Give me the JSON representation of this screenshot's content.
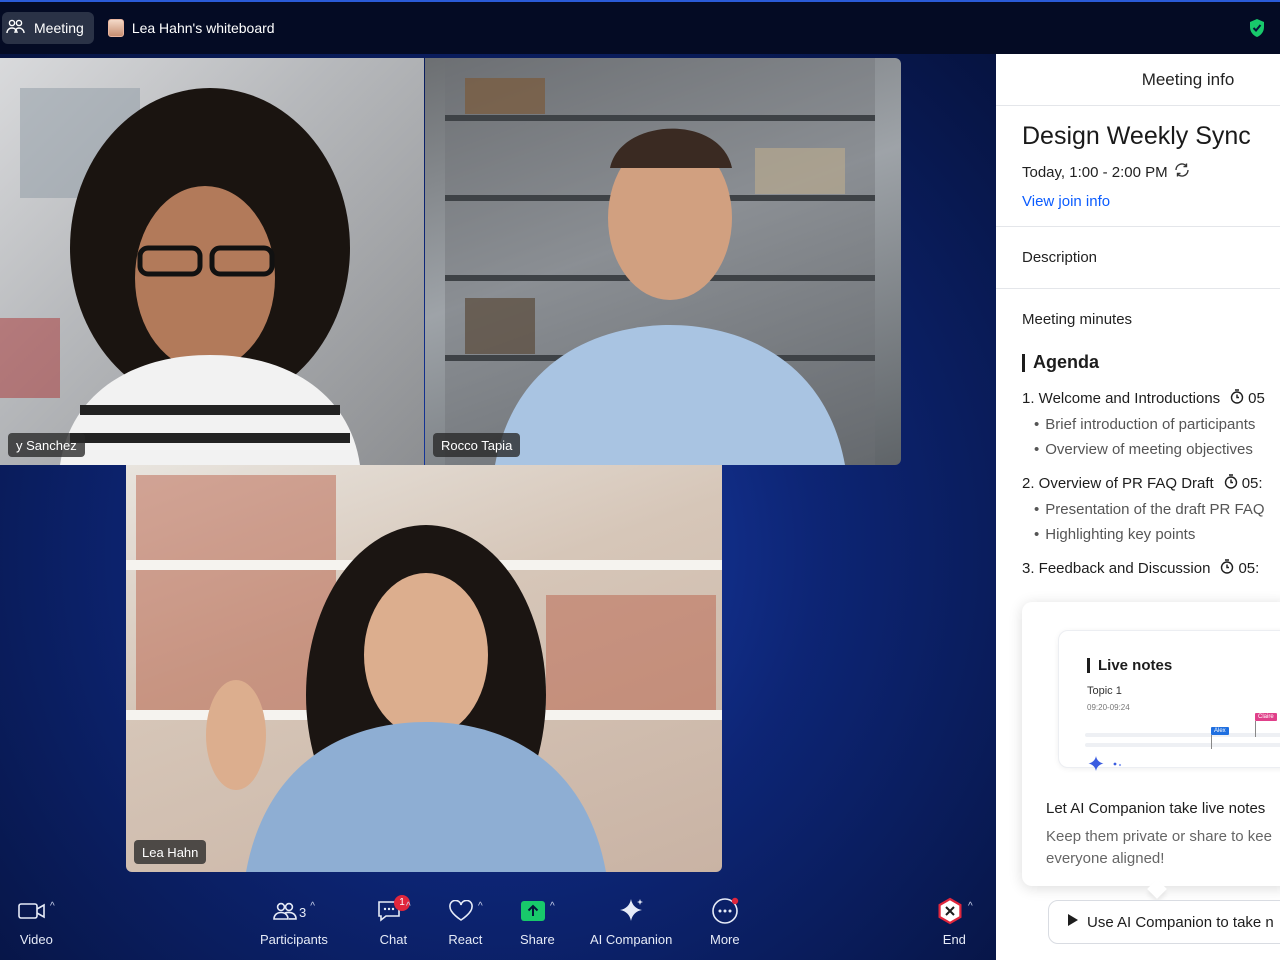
{
  "topbar": {
    "meeting_tab": "Meeting",
    "whiteboard_tab": "Lea Hahn's whiteboard"
  },
  "participants": [
    {
      "name": "y Sanchez"
    },
    {
      "name": "Rocco Tapia"
    },
    {
      "name": "Lea Hahn"
    }
  ],
  "toolbar": {
    "video": "Video",
    "participants": "Participants",
    "participants_count": "3",
    "chat": "Chat",
    "chat_badge": "1",
    "react": "React",
    "share": "Share",
    "ai_companion": "AI Companion",
    "more": "More",
    "end": "End"
  },
  "panel": {
    "header": "Meeting info",
    "title": "Design Weekly Sync",
    "time": "Today, 1:00 - 2:00 PM",
    "join_link": "View join info",
    "description_label": "Description",
    "minutes_label": "Meeting minutes",
    "agenda_heading": "Agenda",
    "agenda": [
      {
        "title": "1. Welcome and Introductions",
        "timer": "05",
        "subs": [
          "Brief introduction of participants",
          "Overview of meeting objectives"
        ]
      },
      {
        "title": "2. Overview of PR FAQ Draft",
        "timer": "05:",
        "subs": [
          "Presentation of the draft PR FAQ",
          "Highlighting key points"
        ]
      },
      {
        "title": "3. Feedback and Discussion",
        "timer": "05:",
        "subs": []
      }
    ],
    "live_notes": {
      "title": "Live notes",
      "topic": "Topic 1",
      "range": "09:20-09:24",
      "flag_alex": "Alex",
      "flag_claire": "Claire"
    },
    "ai_card": {
      "heading": "Let AI Companion take live notes",
      "body": "Keep them private or share to kee everyone aligned!",
      "button": "Use AI Companion to take n"
    }
  },
  "colors": {
    "accent_blue": "#0b5cff",
    "share_green": "#18c96b",
    "end_red": "#e0263c"
  }
}
